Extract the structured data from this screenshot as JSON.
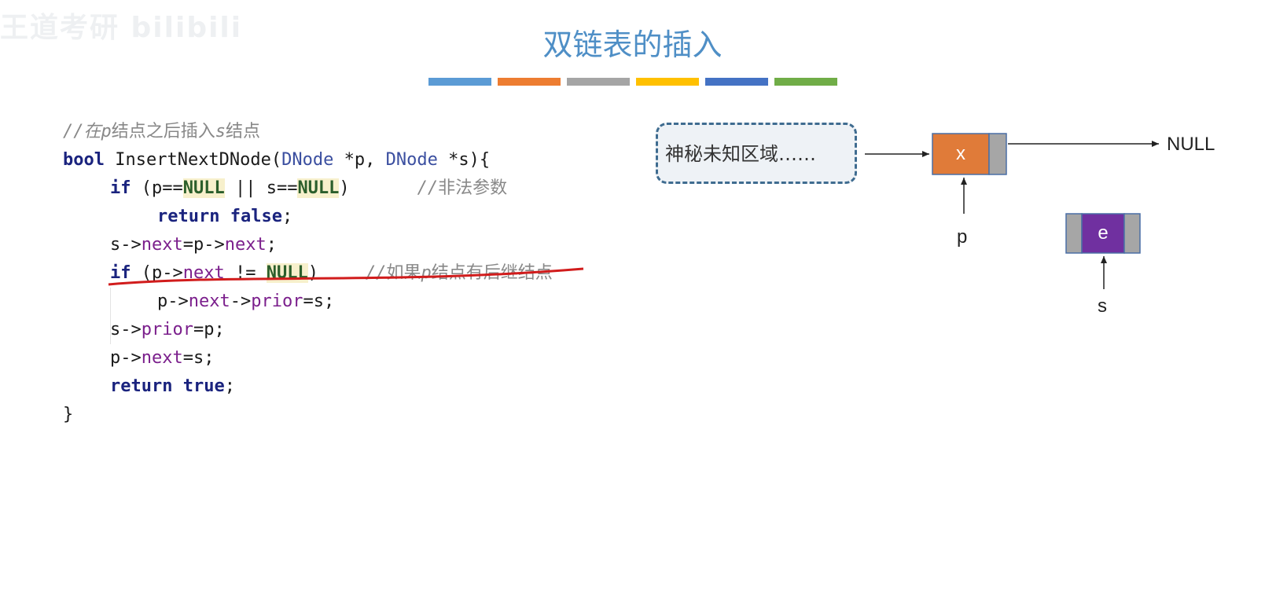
{
  "watermark": "王道考研 bilibili",
  "title": "双链表的插入",
  "color_bars": [
    "#5b9bd5",
    "#ed7d31",
    "#a5a5a5",
    "#ffc000",
    "#4472c4",
    "#70ad47"
  ],
  "code": {
    "comment_prefix": "//在",
    "comment_p": "p",
    "comment_mid": "结点之后插入",
    "comment_s": "s",
    "comment_end": "结点",
    "sig_bool": "bool",
    "sig_name": " InsertNextDNode(",
    "sig_type1": "DNode",
    "sig_p1": " *p, ",
    "sig_type2": "DNode",
    "sig_p2": " *s){",
    "l3_if": "if",
    "l3_a": " (p==",
    "l3_null1": "NULL",
    "l3_b": " || s==",
    "l3_null2": "NULL",
    "l3_c": ")",
    "l3_cm_slash": "//",
    "l3_cm": "非法参数",
    "l4_return": "return",
    "l4_false": "false",
    "l4_semi": ";",
    "l5_a": "s->",
    "l5_next1": "next",
    "l5_b": "=p->",
    "l5_next2": "next",
    "l5_c": ";",
    "l6_if": "if",
    "l6_a": " (p->",
    "l6_next": "next",
    "l6_b": " != ",
    "l6_null": "NULL",
    "l6_c": ")",
    "l6_cm_slash": "//",
    "l6_cm_a": "如果",
    "l6_cm_p": "p",
    "l6_cm_b": "结点有后继结点",
    "l7_a": "p->",
    "l7_next": "next",
    "l7_b": "->",
    "l7_prior": "prior",
    "l7_c": "=s;",
    "l8_a": "s->",
    "l8_prior": "prior",
    "l8_b": "=p;",
    "l9_a": "p->",
    "l9_next": "next",
    "l9_b": "=s;",
    "l10_return": "return",
    "l10_true": "true",
    "l10_semi": ";",
    "close": "}"
  },
  "diagram": {
    "unknown_region": "神秘未知区域……",
    "node_x": "x",
    "node_e": "e",
    "null_label": "NULL",
    "pointer_p": "p",
    "pointer_s": "s",
    "colors": {
      "node_x": "#e07b39",
      "node_e": "#7030a0",
      "pointer_field": "#a6a6a6",
      "node_border": "#4a6fa5",
      "underline": "#d11c1c"
    }
  }
}
